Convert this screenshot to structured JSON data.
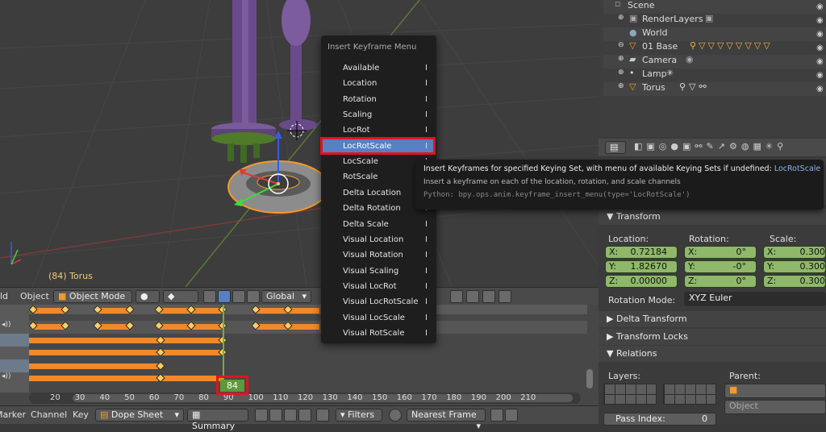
{
  "viewport": {
    "object_label": "(84) Torus"
  },
  "header3d": {
    "menu_partial": "ld",
    "object_menu": "Object",
    "mode": "Object Mode",
    "orientation": "Global"
  },
  "outliner": {
    "items": [
      {
        "label": "Scene"
      },
      {
        "label": "RenderLayers"
      },
      {
        "label": "World"
      },
      {
        "label": "01 Base"
      },
      {
        "label": "Camera"
      },
      {
        "label": "Lamp"
      },
      {
        "label": "Torus"
      }
    ]
  },
  "menu": {
    "title": "Insert Keyframe Menu",
    "items": [
      {
        "label": "Available"
      },
      {
        "label": "Location"
      },
      {
        "label": "Rotation"
      },
      {
        "label": "Scaling"
      },
      {
        "label": "LocRot"
      },
      {
        "label": "LocRotScale"
      },
      {
        "label": "LocScale"
      },
      {
        "label": "RotScale"
      },
      {
        "label": "Delta Location"
      },
      {
        "label": "Delta Rotation"
      },
      {
        "label": "Delta Scale"
      },
      {
        "label": "Visual Location"
      },
      {
        "label": "Visual Rotation"
      },
      {
        "label": "Visual Scaling"
      },
      {
        "label": "Visual LocRot"
      },
      {
        "label": "Visual LocRotScale"
      },
      {
        "label": "Visual LocScale"
      },
      {
        "label": "Visual RotScale"
      }
    ],
    "separator_glyph": "I"
  },
  "tooltip": {
    "line1": "Insert Keyframes for specified Keying Set, with menu of available Keying Sets if undefined:",
    "line1_value": "LocRotScale",
    "line2": "Insert a keyframe on each of the location, rotation, and scale channels",
    "line3": "Python: bpy.ops.anim.keyframe_insert_menu(type='LocRotScale')"
  },
  "properties": {
    "transform_header": "Transform",
    "location_label": "Location:",
    "rotation_label": "Rotation:",
    "scale_label": "Scale:",
    "location": {
      "x": "0.72184",
      "y": "1.82670",
      "z": "0.00000"
    },
    "rotation": {
      "x": "0°",
      "y": "-0°",
      "z": "0°"
    },
    "scale": {
      "x": "0.300",
      "y": "0.300",
      "z": "0.300"
    },
    "axis_x": "X:",
    "axis_y": "Y:",
    "axis_z": "Z:",
    "rotation_mode_label": "Rotation Mode:",
    "rotation_mode_value": "XYZ Euler",
    "delta_transform": "Delta Transform",
    "transform_locks": "Transform Locks",
    "relations": "Relations",
    "layers_label": "Layers:",
    "parent_label": "Parent:",
    "parent_type": "Object",
    "pass_index_label": "Pass Index:",
    "pass_index_value": "0"
  },
  "dopesheet": {
    "current_frame": "84",
    "ticks": [
      "20",
      "30",
      "40",
      "50",
      "60",
      "70",
      "80",
      "90",
      "100",
      "110",
      "120",
      "130",
      "140",
      "150",
      "160",
      "170",
      "180",
      "190",
      "200",
      "210"
    ]
  },
  "bottom_header": {
    "marker": "Marker",
    "channel": "Channel",
    "key": "Key",
    "editor": "Dope Sheet",
    "summary": "Summary",
    "filters": "Filters",
    "snap": "Nearest Frame"
  },
  "colors": {
    "highlight": "#5680c2",
    "annotation_red": "#e0141e",
    "keyframe_bar": "#f0892a",
    "field_green": "#8fb86a"
  }
}
